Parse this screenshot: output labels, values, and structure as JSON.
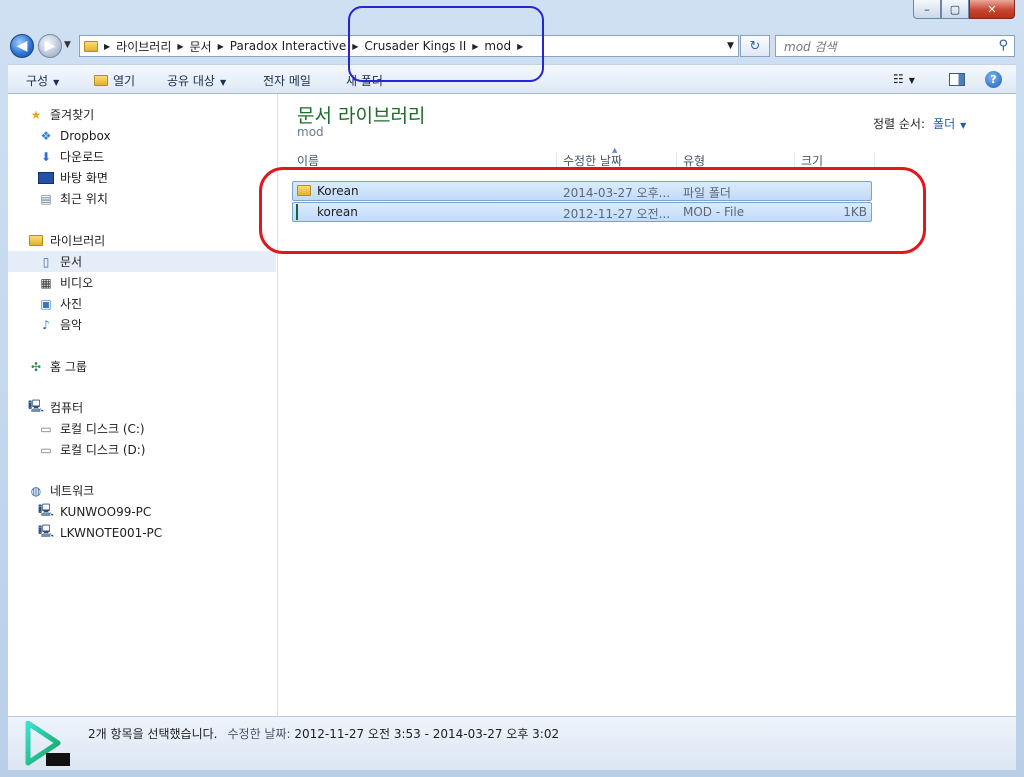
{
  "window": {
    "controls": {
      "minimize": "–",
      "maximize": "▢",
      "close": "✕"
    },
    "back_glyph": "◀",
    "forward_glyph": "▶"
  },
  "address": {
    "breadcrumbs": [
      "라이브러리",
      "문서",
      "Paradox Interactive",
      "Crusader Kings II",
      "mod"
    ],
    "separator": "▶"
  },
  "search": {
    "placeholder": "mod 검색"
  },
  "toolbar": {
    "organize": "구성",
    "open": "열기",
    "share": "공유 대상",
    "email": "전자 메일",
    "new_folder": "새 폴더"
  },
  "nav": {
    "favorites": {
      "header": "즐겨찾기",
      "items": [
        "Dropbox",
        "다운로드",
        "바탕 화면",
        "최근 위치"
      ]
    },
    "libraries": {
      "header": "라이브러리",
      "items": [
        "문서",
        "비디오",
        "사진",
        "음악"
      ],
      "selected": "문서"
    },
    "homegroup": "홈 그룹",
    "computer": {
      "header": "컴퓨터",
      "items": [
        "로컬 디스크 (C:)",
        "로컬 디스크 (D:)"
      ]
    },
    "network": {
      "header": "네트워크",
      "items": [
        "KUNWOO99-PC",
        "LKWNOTE001-PC"
      ]
    }
  },
  "content": {
    "library_title": "문서 라이브러리",
    "library_subtitle": "mod",
    "arrange_label": "정렬 순서:",
    "arrange_value": "폴더",
    "columns": {
      "name": "이름",
      "modified": "수정한 날짜",
      "type": "유형",
      "size": "크기"
    },
    "files": [
      {
        "name": "Korean",
        "modified": "2014-03-27 오후...",
        "type": "파일 폴더",
        "size": "",
        "icon": "folder-icon"
      },
      {
        "name": "korean",
        "modified": "2012-11-27 오전...",
        "type": "MOD - File",
        "size": "1KB",
        "icon": "mod-file-icon"
      }
    ]
  },
  "status": {
    "selection": "2개 항목을 선택했습니다.",
    "modified_label": "수정한 날짜:",
    "modified_range": "2012-11-27 오전 3:53 - 2014-03-27 오후 3:02"
  },
  "colors": {
    "title_green": "#1e6b2a",
    "selection_fill": "#c1dbfa",
    "annotation_blue": "#2525d6",
    "annotation_red": "#e2161d"
  }
}
